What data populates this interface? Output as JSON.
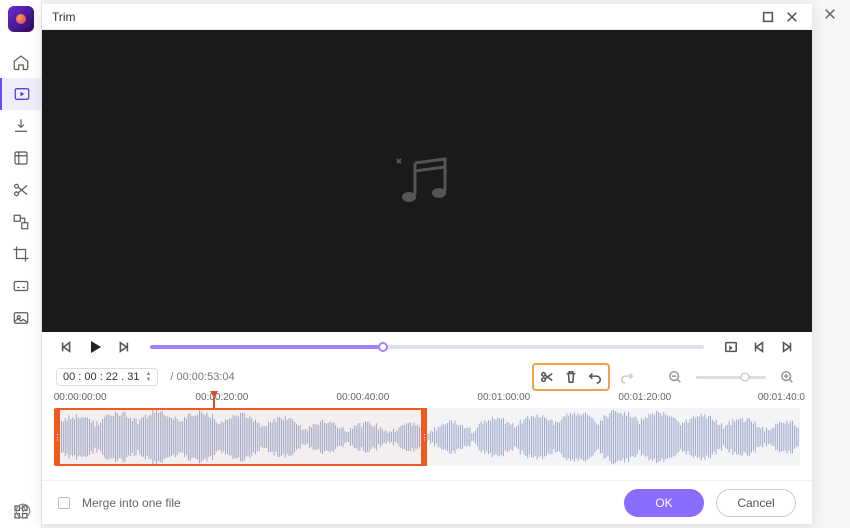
{
  "outer": {
    "close_icon": "close"
  },
  "sidebar": {
    "items": [
      {
        "name": "home-icon"
      },
      {
        "name": "convert-icon"
      },
      {
        "name": "download-icon"
      },
      {
        "name": "compress-icon"
      },
      {
        "name": "trim-icon"
      },
      {
        "name": "merge-icon"
      },
      {
        "name": "crop-icon"
      },
      {
        "name": "caption-icon"
      },
      {
        "name": "watermark-icon"
      },
      {
        "name": "grid-icon"
      }
    ],
    "active_index": 1
  },
  "dialog": {
    "title": "Trim",
    "minimize_icon": "minimize",
    "close_icon": "close"
  },
  "transport": {
    "prev_icon": "step-back",
    "play_icon": "play",
    "next_icon": "step-forward",
    "playhead_percent": 42,
    "pip_icon": "picture-in-picture",
    "prev_marker_icon": "skip-back",
    "next_marker_icon": "skip-forward"
  },
  "time": {
    "current": "00 : 00 : 22 . 31",
    "duration": "/ 00:00:53:04"
  },
  "tools": {
    "cut_icon": "scissors",
    "delete_icon": "trash",
    "undo_icon": "undo",
    "redo_icon": "redo"
  },
  "zoom": {
    "out_icon": "zoom-out",
    "in_icon": "zoom-in",
    "percent": 70
  },
  "ruler": {
    "ticks": [
      "00:00:00:00",
      "00:00:20:00",
      "00:00:40:00",
      "00:01:00:00",
      "00:01:20:00",
      "00:01:40:0"
    ],
    "marker_percent": 21.5
  },
  "timeline": {
    "selection_start_percent": 0,
    "selection_end_percent": 50
  },
  "footer": {
    "merge_label": "Merge into one file",
    "ok_label": "OK",
    "cancel_label": "Cancel"
  }
}
